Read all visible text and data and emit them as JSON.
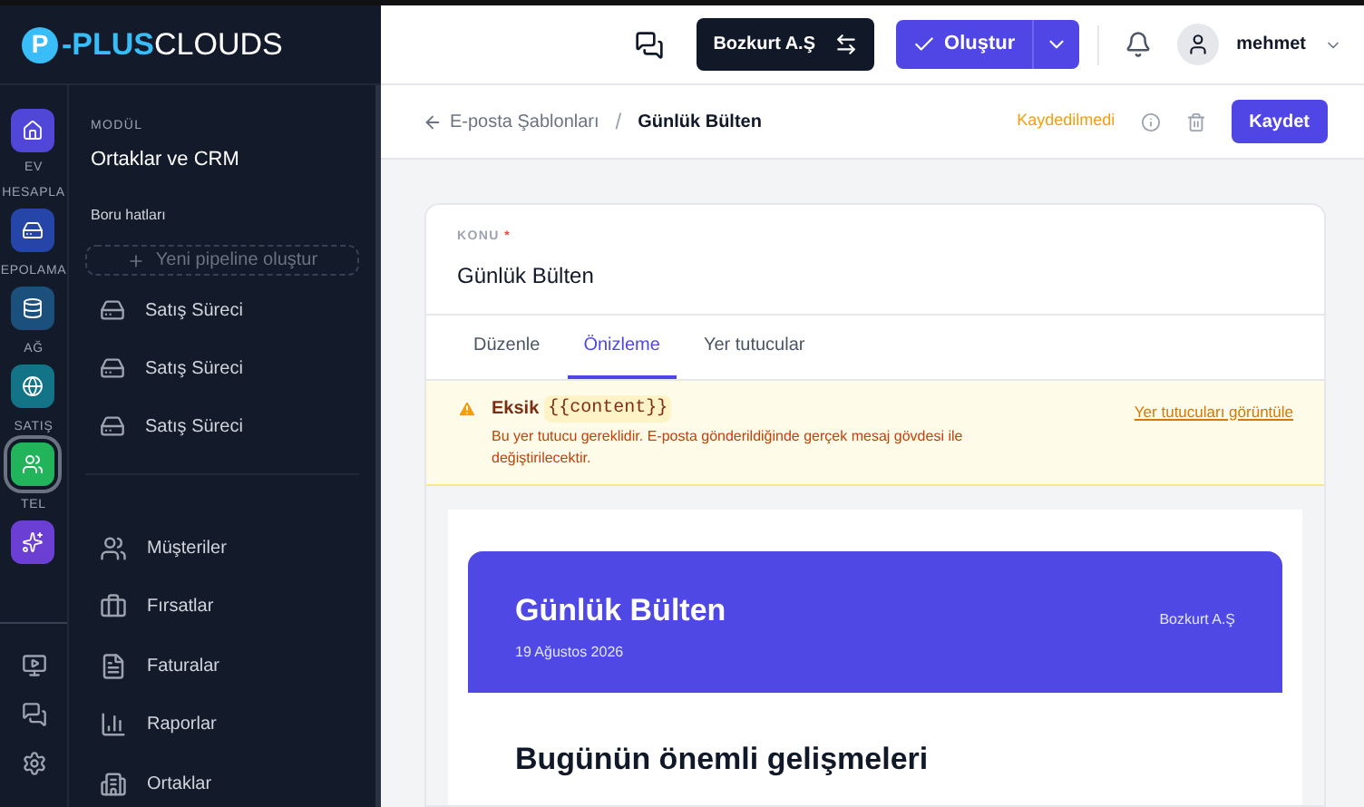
{
  "brand": {
    "logo_mark": "P",
    "logo_text_bold": "-PLUS",
    "logo_text_light": "CLOUDS"
  },
  "rail": {
    "items": [
      {
        "label": "EV",
        "color": "#5046d8",
        "selected": false
      },
      {
        "label": "HESAPLA",
        "color": "#2546a8",
        "selected": false
      },
      {
        "label": "EPOLAMA",
        "color": "#1b4f7c",
        "selected": false
      },
      {
        "label": "AĞ",
        "color": "#137488",
        "selected": false
      },
      {
        "label": "SATIŞ",
        "color": "#22b45a",
        "selected": true
      },
      {
        "label": "TEL",
        "color": "#6b3fd4",
        "selected": false
      }
    ]
  },
  "module": {
    "caption": "MODÜL",
    "title": "Ortaklar ve CRM",
    "section": "Boru hatları",
    "new_button": "Yeni pipeline oluştur",
    "pipelines": [
      "Satış Süreci",
      "Satış Süreci",
      "Satış Süreci"
    ],
    "nav": [
      "Müşteriler",
      "Fırsatlar",
      "Faturalar",
      "Raporlar",
      "Ortaklar"
    ]
  },
  "header": {
    "company": "Bozkurt A.Ş",
    "create": "Oluştur",
    "user": "mehmet"
  },
  "breadcrumb": {
    "parent": "E-posta Şablonları",
    "separator": "/",
    "current": "Günlük Bülten",
    "status": "Kaydedilmedi",
    "save": "Kaydet"
  },
  "subject": {
    "label": "KONU",
    "required_mark": "*",
    "value": "Günlük Bülten"
  },
  "tabs": [
    {
      "label": "Düzenle",
      "selected": false
    },
    {
      "label": "Önizleme",
      "selected": true
    },
    {
      "label": "Yer tutucular",
      "selected": false
    }
  ],
  "warning": {
    "title": "Eksik",
    "code": "{{content}}",
    "text": "Bu yer tutucu gereklidir. E-posta gönderildiğinde gerçek mesaj gövdesi ile değiştirilecektir.",
    "link": "Yer tutucuları görüntüle"
  },
  "email": {
    "title": "Günlük Bülten",
    "date": "19 Ağustos 2026",
    "company": "Bozkurt A.Ş",
    "heading": "Bugünün önemli gelişmeleri"
  }
}
